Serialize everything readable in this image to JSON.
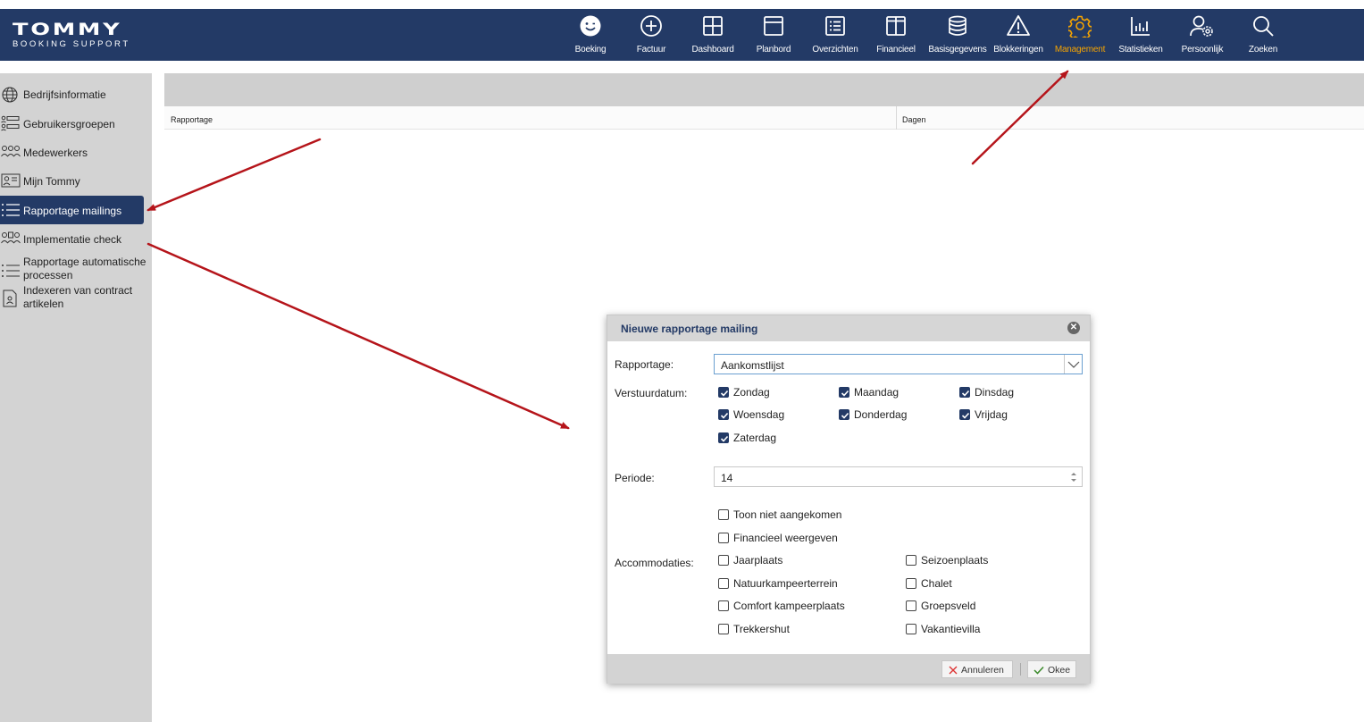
{
  "brand": {
    "name": "TOMMY",
    "tagline": "BOOKING SUPPORT"
  },
  "nav": [
    {
      "label": "Boeking",
      "icon": "smiley-icon"
    },
    {
      "label": "Factuur",
      "icon": "plus-circle-icon"
    },
    {
      "label": "Dashboard",
      "icon": "grid-icon"
    },
    {
      "label": "Planbord",
      "icon": "window-icon"
    },
    {
      "label": "Overzichten",
      "icon": "list-box-icon"
    },
    {
      "label": "Financieel",
      "icon": "columns-icon"
    },
    {
      "label": "Basisgegevens",
      "icon": "database-icon"
    },
    {
      "label": "Blokkeringen",
      "icon": "warning-icon"
    },
    {
      "label": "Management",
      "icon": "gear-icon",
      "active": true
    },
    {
      "label": "Statistieken",
      "icon": "bar-chart-icon"
    },
    {
      "label": "Persoonlijk",
      "icon": "user-gear-icon"
    },
    {
      "label": "Zoeken",
      "icon": "search-icon"
    }
  ],
  "sidebar": {
    "items": [
      {
        "label": "Bedrijfsinformatie",
        "icon": "globe-icon"
      },
      {
        "label": "Gebruikersgroepen",
        "icon": "user-groups-icon"
      },
      {
        "label": "Medewerkers",
        "icon": "people-icon"
      },
      {
        "label": "Mijn Tommy",
        "icon": "id-card-icon"
      },
      {
        "label": "Rapportage mailings",
        "icon": "list-icon",
        "active": true
      },
      {
        "label": "Implementatie check",
        "icon": "people-check-icon"
      },
      {
        "label": "Rapportage automatische processen",
        "icon": "list-icon"
      },
      {
        "label": "Indexeren van contract artikelen",
        "icon": "contract-icon"
      }
    ]
  },
  "grid": {
    "columns": [
      "Rapportage",
      "Dagen"
    ]
  },
  "modal": {
    "title": "Nieuwe rapportage mailing",
    "rapportage_label": "Rapportage:",
    "rapportage_value": "Aankomstlijst",
    "verstuurdatum_label": "Verstuurdatum:",
    "days": [
      {
        "label": "Zondag",
        "checked": true
      },
      {
        "label": "Maandag",
        "checked": true
      },
      {
        "label": "Dinsdag",
        "checked": true
      },
      {
        "label": "Woensdag",
        "checked": true
      },
      {
        "label": "Donderdag",
        "checked": true
      },
      {
        "label": "Vrijdag",
        "checked": true
      },
      {
        "label": "Zaterdag",
        "checked": true
      }
    ],
    "periode_label": "Periode:",
    "periode_value": "14",
    "options": [
      {
        "label": "Toon niet aangekomen",
        "checked": false
      },
      {
        "label": "Financieel weergeven",
        "checked": false
      }
    ],
    "accommodaties_label": "Accommodaties:",
    "accommodaties": [
      {
        "label": "Jaarplaats",
        "checked": false
      },
      {
        "label": "Seizoenplaats",
        "checked": false
      },
      {
        "label": "Natuurkampeerterrein",
        "checked": false
      },
      {
        "label": "Chalet",
        "checked": false
      },
      {
        "label": "Comfort kampeerplaats",
        "checked": false
      },
      {
        "label": "Groepsveld",
        "checked": false
      },
      {
        "label": "Trekkershut",
        "checked": false
      },
      {
        "label": "Vakantievilla",
        "checked": false
      }
    ],
    "cancel_label": "Annuleren",
    "ok_label": "Okee"
  },
  "colors": {
    "navy": "#233a66",
    "accent": "#f6a400",
    "annotation": "#b5141a"
  }
}
